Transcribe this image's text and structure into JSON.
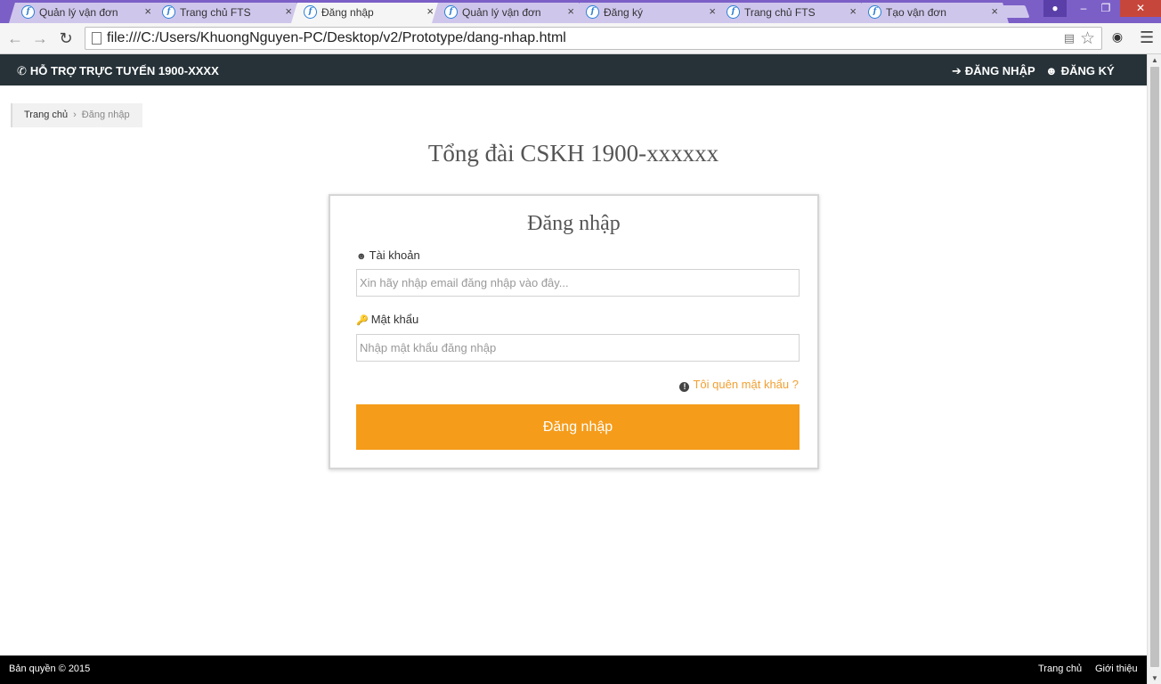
{
  "browser": {
    "tabs": [
      {
        "title": "Quản lý vận đơn",
        "active": false
      },
      {
        "title": "Trang chủ FTS",
        "active": false
      },
      {
        "title": "Đăng nhập",
        "active": true
      },
      {
        "title": "Quản lý vận đơn",
        "active": false
      },
      {
        "title": "Đăng ký",
        "active": false
      },
      {
        "title": "Trang chủ FTS",
        "active": false
      },
      {
        "title": "Tạo vận đơn",
        "active": false
      }
    ],
    "url": "file:///C:/Users/KhuongNguyen-PC/Desktop/v2/Prototype/dang-nhap.html",
    "tab_close_glyph": "×"
  },
  "topbar": {
    "hotline": "HỖ TRỢ TRỰC TUYẾN 1900-XXXX",
    "login": "ĐĂNG NHẬP",
    "register": "ĐĂNG KÝ",
    "background": "#263238"
  },
  "breadcrumb": {
    "home": "Trang chủ",
    "separator": "›",
    "current": "Đăng nhập"
  },
  "hotline_title": "Tổng đài CSKH 1900-xxxxxx",
  "login_form": {
    "title": "Đăng nhập",
    "account_label": "Tài khoản",
    "account_placeholder": "Xin hãy nhập email đăng nhập vào đây...",
    "account_value": "",
    "password_label": "Mật khẩu",
    "password_placeholder": "Nhập mật khẩu đăng nhập",
    "password_value": "",
    "forgot_password": "Tôi quên mật khẩu ?",
    "submit_label": "Đăng nhập",
    "accent_color": "#f59c1a"
  },
  "footer": {
    "copyright": "Bản quyền © 2015",
    "home": "Trang chủ",
    "about": "Giới thiệu"
  }
}
